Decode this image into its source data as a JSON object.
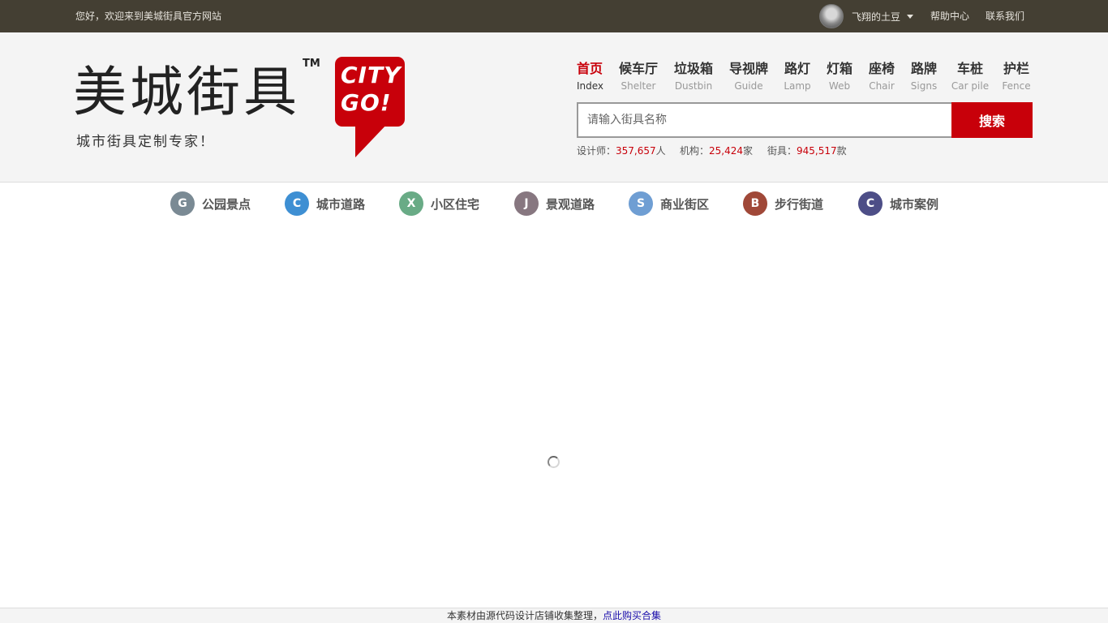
{
  "topbar": {
    "welcome": "您好，欢迎来到美城街具官方网站",
    "username": "飞翔的土豆",
    "help": "帮助中心",
    "contact": "联系我们"
  },
  "logo": {
    "name": "美城街具",
    "tm": "TM",
    "slogan": "城市街具定制专家！",
    "badge_line1": "CITY",
    "badge_line2": "GO!"
  },
  "nav": [
    {
      "cn": "首页",
      "en": "Index",
      "active": true
    },
    {
      "cn": "候车厅",
      "en": "Shelter"
    },
    {
      "cn": "垃圾箱",
      "en": "Dustbin"
    },
    {
      "cn": "导视牌",
      "en": "Guide"
    },
    {
      "cn": "路灯",
      "en": "Lamp"
    },
    {
      "cn": "灯箱",
      "en": "Web"
    },
    {
      "cn": "座椅",
      "en": "Chair"
    },
    {
      "cn": "路牌",
      "en": "Signs"
    },
    {
      "cn": "车桩",
      "en": "Car pile"
    },
    {
      "cn": "护栏",
      "en": "Fence"
    }
  ],
  "search": {
    "placeholder": "请输入街具名称",
    "button": "搜索"
  },
  "stats": [
    {
      "label": "设计师：",
      "value": "357,657",
      "unit": "人"
    },
    {
      "label": "机构：",
      "value": "25,424",
      "unit": "家"
    },
    {
      "label": "街具：",
      "value": "945,517",
      "unit": "款"
    }
  ],
  "categories": [
    {
      "letter": "G",
      "label": "公园景点",
      "color": "#7a8a94"
    },
    {
      "letter": "C",
      "label": "城市道路",
      "color": "#3e8fd3"
    },
    {
      "letter": "X",
      "label": "小区住宅",
      "color": "#69ab86"
    },
    {
      "letter": "J",
      "label": "景观道路",
      "color": "#877780"
    },
    {
      "letter": "S",
      "label": "商业街区",
      "color": "#6f9ed3"
    },
    {
      "letter": "B",
      "label": "步行街道",
      "color": "#a04838"
    },
    {
      "letter": "C",
      "label": "城市案例",
      "color": "#4d4e87"
    }
  ],
  "footer": {
    "text": "本素材由源代码设计店铺收集整理，",
    "link": "点此购买合集"
  },
  "colors": {
    "accent": "#c8000a",
    "topbar": "#443f33"
  }
}
